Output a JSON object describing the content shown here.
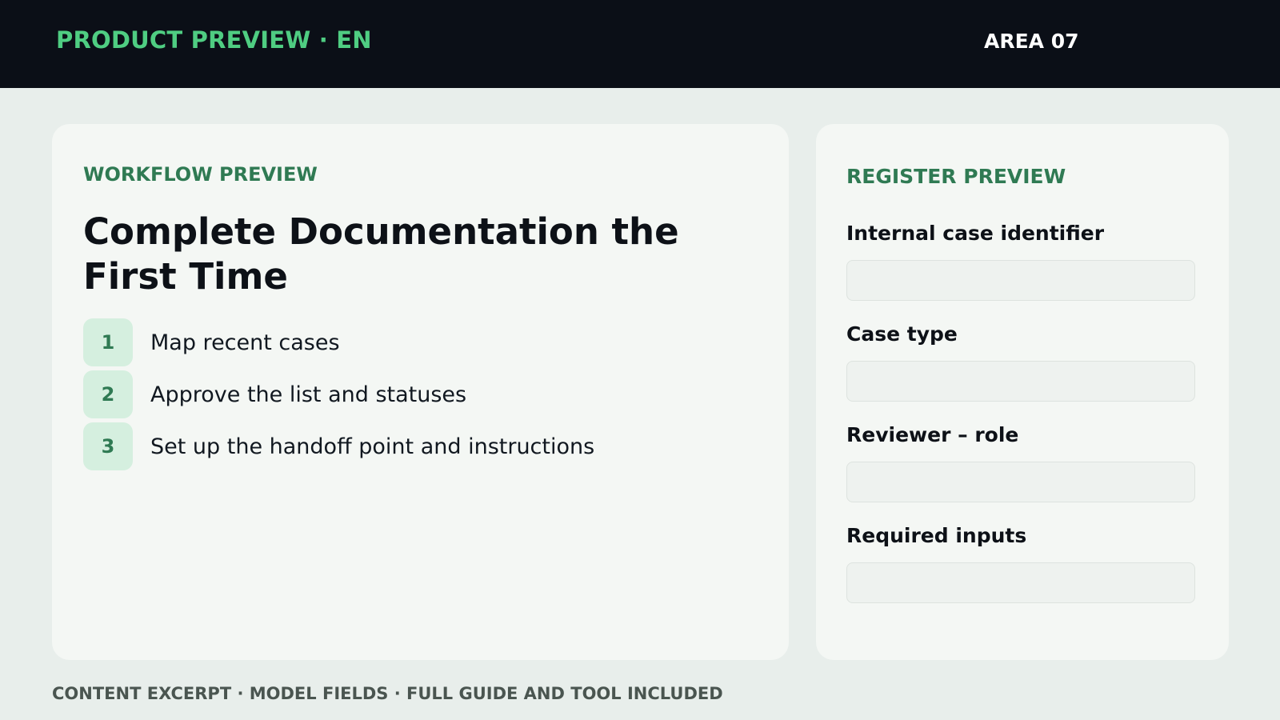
{
  "header": {
    "brand": "PRODUCT PREVIEW · EN",
    "area": "AREA 07"
  },
  "workflow": {
    "eyebrow": "WORKFLOW PREVIEW",
    "title": "Complete Documentation the First Time",
    "steps": [
      {
        "number": "1",
        "label": "Map recent cases"
      },
      {
        "number": "2",
        "label": "Approve the list and statuses"
      },
      {
        "number": "3",
        "label": "Set up the handoff point and instructions"
      }
    ]
  },
  "register": {
    "eyebrow": "REGISTER PREVIEW",
    "fields": [
      {
        "label": "Internal case identifier",
        "value": ""
      },
      {
        "label": "Case type",
        "value": ""
      },
      {
        "label": "Reviewer – role",
        "value": ""
      },
      {
        "label": "Required inputs",
        "value": ""
      }
    ]
  },
  "footer": {
    "note": "CONTENT EXCERPT · MODEL FIELDS · FULL GUIDE AND TOOL INCLUDED"
  },
  "colors": {
    "topbar": "#0b0f17",
    "brand_accent": "#4fcd82",
    "section_accent": "#2f7a53",
    "badge_bg": "#d5efdf",
    "page_bg": "#e8eeeb",
    "card_bg": "#f4f7f4"
  }
}
